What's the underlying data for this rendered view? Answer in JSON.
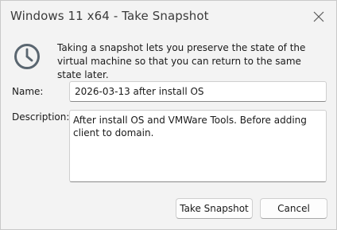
{
  "window": {
    "title": "Windows 11 x64 - Take Snapshot"
  },
  "info": {
    "icon": "clock-icon",
    "text": "Taking a snapshot lets you preserve the state of the virtual machine so that you can return to the same state later."
  },
  "form": {
    "name_label": "Name:",
    "name_value": "2026-03-13 after install OS",
    "description_label": "Description:",
    "description_value": "After install OS and VMWare Tools. Before adding client to domain."
  },
  "buttons": {
    "take_snapshot": "Take Snapshot",
    "cancel": "Cancel"
  },
  "colors": {
    "background": "#f3f3f3",
    "field_border": "#cfcfcf",
    "icon": "#5a6670"
  }
}
